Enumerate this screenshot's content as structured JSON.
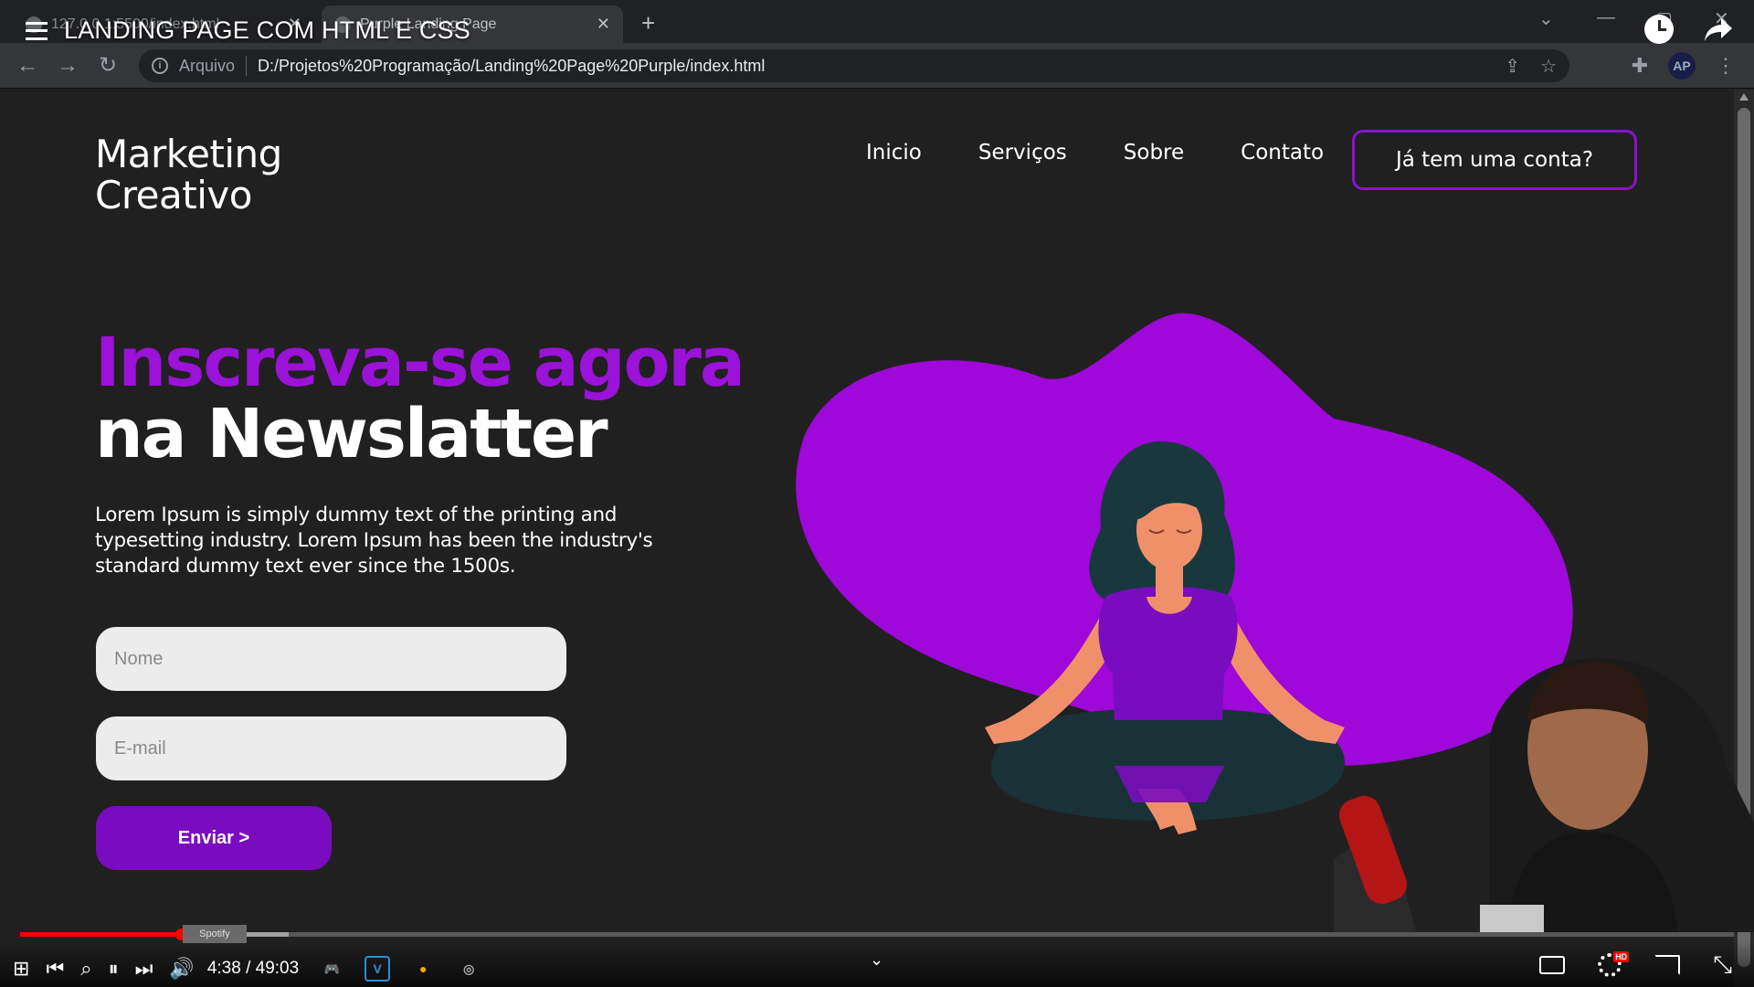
{
  "browser": {
    "tabs": [
      {
        "label": "127.0.0.1:5500/index.html"
      },
      {
        "label": "Purple Landing Page"
      }
    ],
    "address_label": "Arquivo",
    "url": "D:/Projetos%20Programação/Landing%20Page%20Purple/index.html",
    "profile_initials": "AP"
  },
  "video": {
    "title": "LANDING PAGE COM HTML E CSS",
    "current_time": "4:38",
    "duration": "49:03",
    "time_display": "4:38 / 49:03",
    "progress_fraction": 0.094,
    "hd_badge": "HD",
    "preview_chip": "Spotify"
  },
  "page": {
    "logo_line1": "Marketing",
    "logo_line2": "Creativo",
    "nav": {
      "items": [
        "Inicio",
        "Serviços",
        "Sobre",
        "Contato"
      ],
      "login_label": "Já tem uma conta?"
    },
    "hero_line1": "Inscreva-se agora",
    "hero_line2": "na Newslatter",
    "lead": "Lorem Ipsum is simply dummy text of the printing and typesetting industry. Lorem Ipsum has been the industry's standard dummy text ever since the 1500s.",
    "form": {
      "name_placeholder": "Nome",
      "email_placeholder": "E-mail",
      "submit_label": "Enviar >"
    }
  },
  "colors": {
    "background": "#202020",
    "accent_purple": "#9b12d8",
    "button_purple": "#7a0cbf",
    "blob_purple": "#9e08d8",
    "progress_red": "#ff0000"
  }
}
